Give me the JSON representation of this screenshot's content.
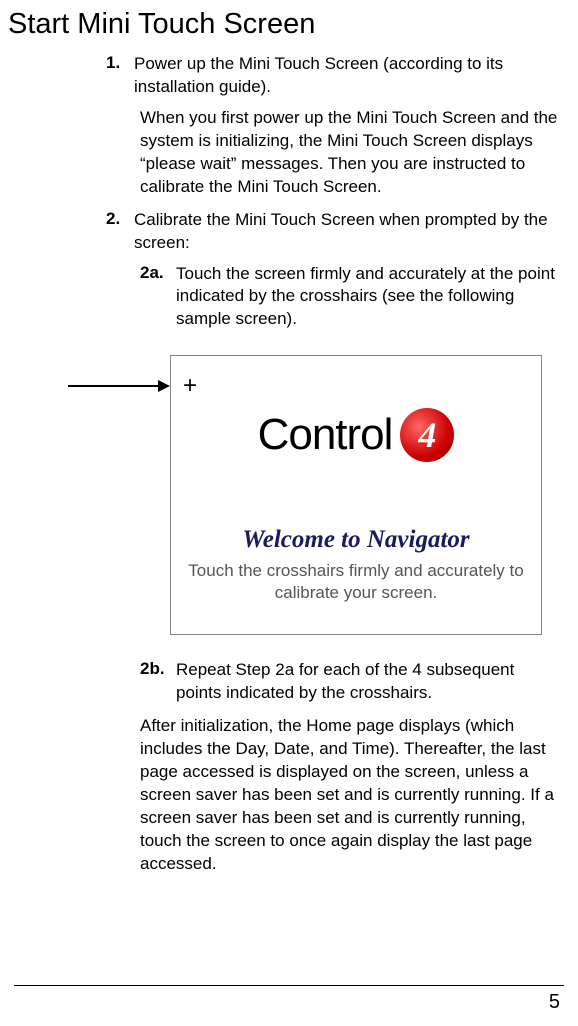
{
  "title": "Start Mini Touch Screen",
  "steps": {
    "s1": {
      "num": "1.",
      "body": "Power up the Mini Touch Screen (according to its installation guide).",
      "note": "When you first power up the Mini Touch Screen and the system is initializing, the Mini Touch Screen displays “please wait” messages. Then you are instructed to calibrate the Mini Touch Screen."
    },
    "s2": {
      "num": "2.",
      "body": "Calibrate the Mini Touch Screen when prompted by the screen:",
      "sub_a": {
        "num": "2a.",
        "body": "Touch the screen firmly and accurately at the point indicated by the crosshairs (see the following sample screen)."
      },
      "sub_b": {
        "num": "2b.",
        "body": "Repeat Step 2a for each of the 4 subsequent points indicated by the crosshairs."
      },
      "after": "After initialization, the Home page displays (which includes the Day, Date, and Time). Thereafter, the last page accessed is displayed on the screen, unless a screen saver has been set and is currently running. If a screen saver has been set and is currently running, touch the screen to once again display the last page accessed."
    }
  },
  "sample_screen": {
    "crosshair": "+",
    "logo_text": "Control",
    "logo_digit": "4",
    "welcome_heading": "Welcome to Navigator",
    "welcome_sub": "Touch the crosshairs firmly and accurately to calibrate your screen."
  },
  "page_number": "5"
}
